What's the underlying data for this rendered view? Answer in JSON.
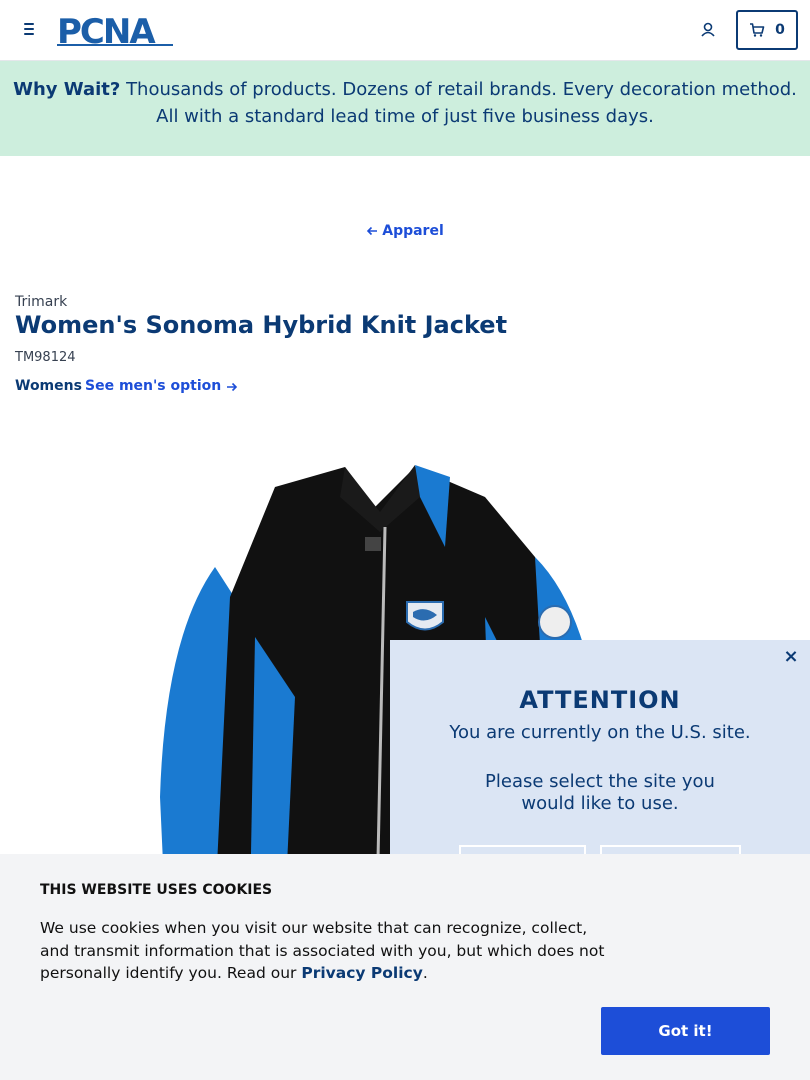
{
  "header": {
    "logo_text": "PCNA",
    "cart_count": "0",
    "icons": {
      "menu": "menu-icon",
      "account": "user-icon",
      "cart": "cart-icon"
    },
    "brand_color": "#0b3a74"
  },
  "promo": {
    "lead": "Why Wait?",
    "text": " Thousands of products. Dozens of retail brands. Every decoration method. All with a standard lead time of just five business days.",
    "background": "#cdeedd"
  },
  "breadcrumb": {
    "back_label": "Apparel"
  },
  "product": {
    "brand": "Trimark",
    "title": "Women's Sonoma Hybrid Knit Jacket",
    "sku": "TM98124",
    "gender": "Womens",
    "alt_option_label": "See men's option"
  },
  "attention": {
    "title": "ATTENTION",
    "subtitle": "You are currently on the U.S. site.",
    "message": "Please select the site you would like to use.",
    "close_label": "×"
  },
  "cookie": {
    "title": "THIS WEBSITE USES COOKIES",
    "text": "We use cookies when you visit our website that can recognize, collect, and transmit information that is associated with you, but which does not personally identify you. Read our ",
    "policy_link": "Privacy Policy",
    "text_end": ".",
    "button_label": "Got it!",
    "button_color": "#1d4ed8"
  }
}
